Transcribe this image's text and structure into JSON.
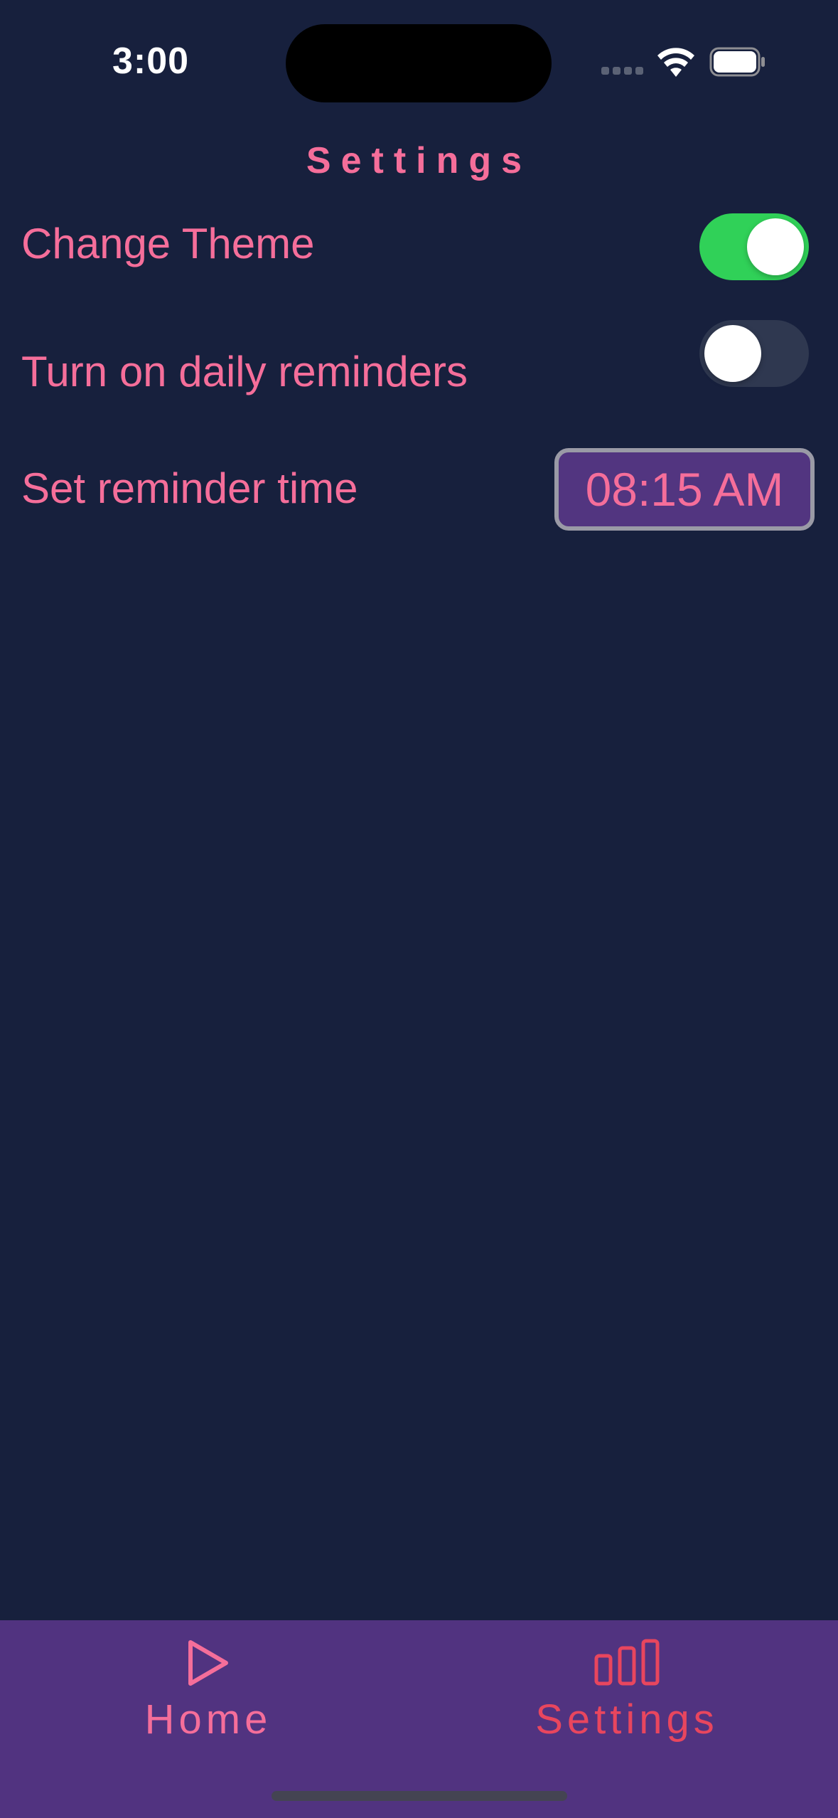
{
  "status_bar": {
    "time": "3:00",
    "icons": [
      "signal-icon",
      "wifi-icon",
      "battery-icon"
    ]
  },
  "page": {
    "title": "Settings"
  },
  "settings": {
    "change_theme": {
      "label": "Change Theme",
      "enabled": true
    },
    "daily_reminders": {
      "label": "Turn on daily reminders",
      "enabled": false
    },
    "reminder_time": {
      "label": "Set reminder time",
      "value": "08:15 AM"
    }
  },
  "tab_bar": {
    "tabs": [
      {
        "label": "Home",
        "icon": "play-icon",
        "selected": false
      },
      {
        "label": "Settings",
        "icon": "bar-chart-icon",
        "selected": true
      }
    ]
  },
  "colors": {
    "background": "#17203D",
    "accent_pink": "#F56E9A",
    "selected_tab": "#E8465E",
    "tab_bar": "#513380",
    "toggle_on": "#30D158",
    "toggle_off": "#2F3850",
    "time_picker_bg": "#523580"
  }
}
